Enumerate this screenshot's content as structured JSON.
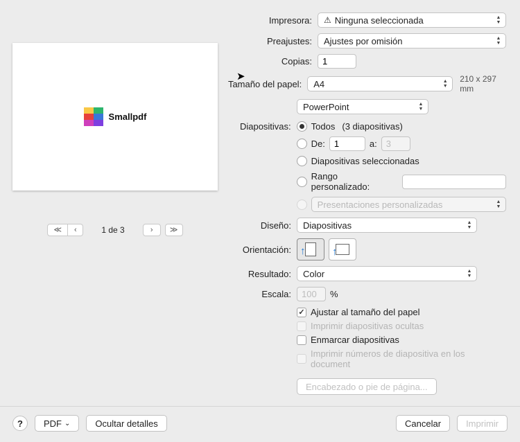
{
  "labels": {
    "printer": "Impresora:",
    "presets": "Preajustes:",
    "copies": "Copias:",
    "paper_size": "Tamaño del papel:",
    "slides": "Diapositivas:",
    "layout": "Diseño:",
    "orientation": "Orientación:",
    "output": "Resultado:",
    "scale": "Escala:"
  },
  "printer_value": "Ninguna seleccionada",
  "presets_value": "Ajustes por omisión",
  "copies_value": "1",
  "paper_size_value": "A4",
  "paper_dim": "210 x 297 mm",
  "app_select": "PowerPoint",
  "slides_radio": {
    "all": "Todos",
    "all_count": "(3 diapositivas)",
    "from": "De:",
    "to": "a:",
    "from_val": "1",
    "to_val": "3",
    "selected": "Diapositivas seleccionadas",
    "custom_range": "Rango personalizado:",
    "custom_shows": "Presentaciones personalizadas"
  },
  "layout_value": "Diapositivas",
  "output_value": "Color",
  "scale_value": "100",
  "scale_pct": "%",
  "checks": {
    "fit_paper": "Ajustar al tamaño del papel",
    "hidden": "Imprimir diapositivas ocultas",
    "frame": "Enmarcar diapositivas",
    "numbers": "Imprimir números de diapositiva en los document"
  },
  "header_footer_btn": "Encabezado o pie de página...",
  "preview": {
    "brand": "Smallpdf",
    "pager": "1 de 3"
  },
  "bottom": {
    "help": "?",
    "pdf": "PDF",
    "hide_details": "Ocultar detalles",
    "cancel": "Cancelar",
    "print": "Imprimir"
  }
}
